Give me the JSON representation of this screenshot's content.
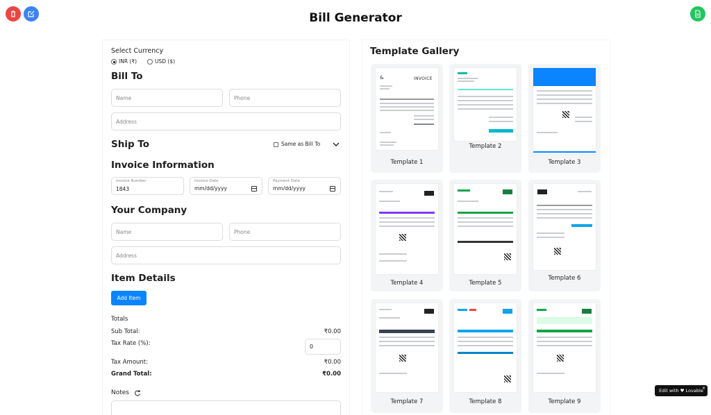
{
  "app": {
    "title": "Bill Generator"
  },
  "currency": {
    "label": "Select Currency",
    "options": [
      "INR (₹)",
      "USD ($)"
    ],
    "selected": "INR (₹)"
  },
  "bill_to": {
    "heading": "Bill To",
    "name_placeholder": "Name",
    "phone_placeholder": "Phone",
    "address_placeholder": "Address"
  },
  "ship_to": {
    "heading": "Ship To",
    "same_as_label": "Same as Bill To"
  },
  "invoice_info": {
    "heading": "Invoice Information",
    "invoice_number_label": "Invoice Number",
    "invoice_number_value": "1843",
    "invoice_date_label": "Invoice Date",
    "invoice_date_value": "mm/dd/yyyy",
    "payment_date_label": "Payment Date",
    "payment_date_value": "mm/dd/yyyy"
  },
  "company": {
    "heading": "Your Company",
    "name_placeholder": "Name",
    "phone_placeholder": "Phone",
    "address_placeholder": "Address"
  },
  "items": {
    "heading": "Item Details",
    "add_button": "Add Item"
  },
  "totals": {
    "heading": "Totals",
    "sub_total_label": "Sub Total:",
    "sub_total_value": "₹0.00",
    "tax_rate_label": "Tax Rate (%):",
    "tax_rate_value": "0",
    "tax_amount_label": "Tax Amount:",
    "tax_amount_value": "₹0.00",
    "grand_total_label": "Grand Total:",
    "grand_total_value": "₹0.00"
  },
  "notes": {
    "label": "Notes"
  },
  "gallery": {
    "title": "Template Gallery",
    "templates": [
      "Template 1",
      "Template 2",
      "Template 3",
      "Template 4",
      "Template 5",
      "Template 6",
      "Template 7",
      "Template 8",
      "Template 9"
    ],
    "template_1_heading": "INVOICE"
  },
  "badge": {
    "text": "Edit with ♥ Lovable",
    "close": "×"
  },
  "colors": {
    "delete": "#ef4444",
    "edit": "#3b82f6",
    "download": "#22c55e",
    "primary": "#0a84ff"
  },
  "icons": {
    "delete": "trash-icon",
    "edit": "edit-icon",
    "download": "document-icon",
    "chevron": "chevron-down-icon",
    "refresh": "refresh-icon"
  }
}
